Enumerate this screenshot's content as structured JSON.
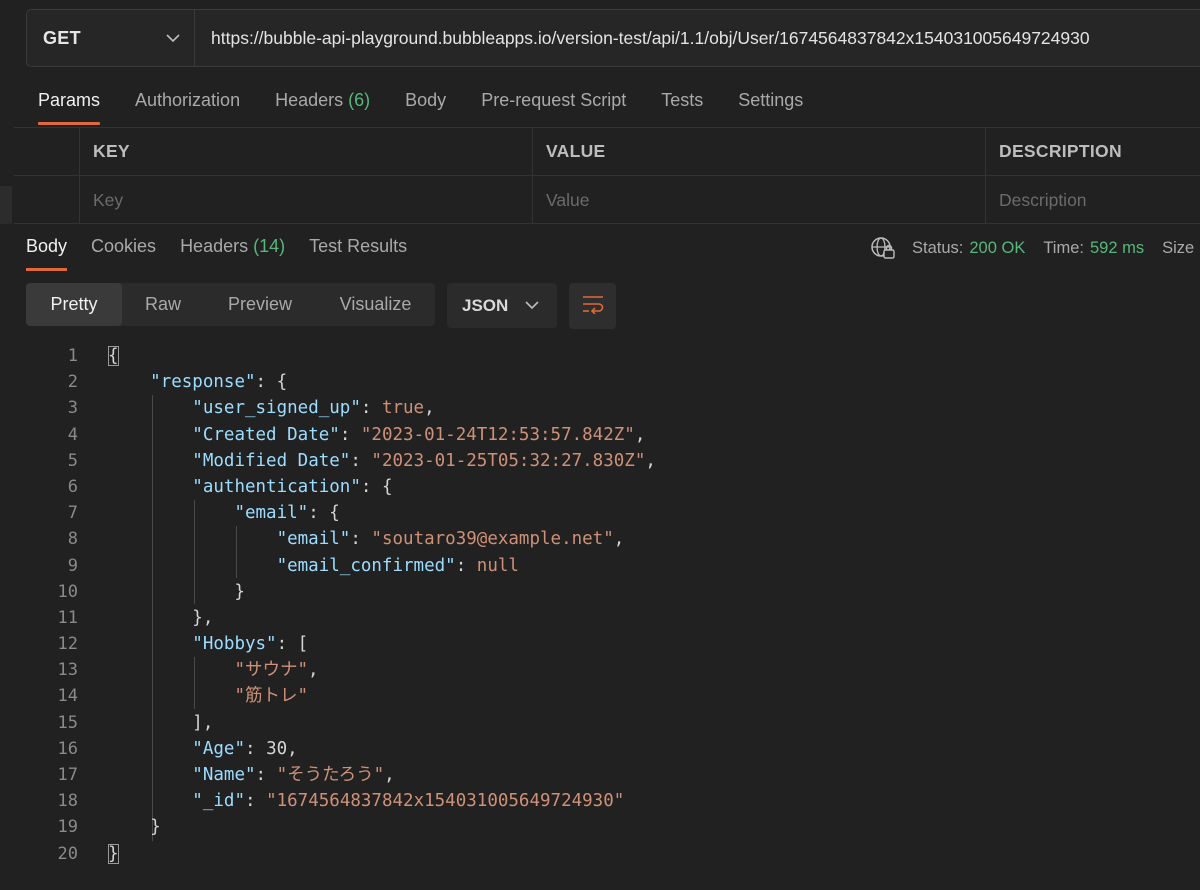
{
  "request": {
    "method": "GET",
    "url": "https://bubble-api-playground.bubbleapps.io/version-test/api/1.1/obj/User/1674564837842x154031005649724930"
  },
  "request_tabs": [
    {
      "label": "Params",
      "count": ""
    },
    {
      "label": "Authorization",
      "count": ""
    },
    {
      "label": "Headers",
      "count": "(6)"
    },
    {
      "label": "Body",
      "count": ""
    },
    {
      "label": "Pre-request Script",
      "count": ""
    },
    {
      "label": "Tests",
      "count": ""
    },
    {
      "label": "Settings",
      "count": ""
    }
  ],
  "params_table": {
    "headers": [
      "KEY",
      "VALUE",
      "DESCRIPTION"
    ],
    "placeholders": [
      "Key",
      "Value",
      "Description"
    ]
  },
  "response_tabs": [
    {
      "label": "Body",
      "count": ""
    },
    {
      "label": "Cookies",
      "count": ""
    },
    {
      "label": "Headers",
      "count": "(14)"
    },
    {
      "label": "Test Results",
      "count": ""
    }
  ],
  "status": {
    "status_label": "Status:",
    "status_value": "200 OK",
    "time_label": "Time:",
    "time_value": "592 ms",
    "size_label": "Size"
  },
  "view_modes": [
    "Pretty",
    "Raw",
    "Preview",
    "Visualize"
  ],
  "format": "JSON",
  "code_lines": [
    "{",
    "    \"response\": {",
    "        \"user_signed_up\": true,",
    "        \"Created Date\": \"2023-01-24T12:53:57.842Z\",",
    "        \"Modified Date\": \"2023-01-25T05:32:27.830Z\",",
    "        \"authentication\": {",
    "            \"email\": {",
    "                \"email\": \"soutaro39@example.net\",",
    "                \"email_confirmed\": null",
    "            }",
    "        },",
    "        \"Hobbys\": [",
    "            \"サウナ\",",
    "            \"筋トレ\"",
    "        ],",
    "        \"Age\": 30,",
    "        \"Name\": \"そうたろう\",",
    "        \"_id\": \"1674564837842x154031005649724930\"",
    "    }",
    "}"
  ],
  "colors": {
    "accent": "#e0683a",
    "count_green": "#56b77c",
    "json_key": "#9cdcfe",
    "json_string": "#ce9178"
  }
}
